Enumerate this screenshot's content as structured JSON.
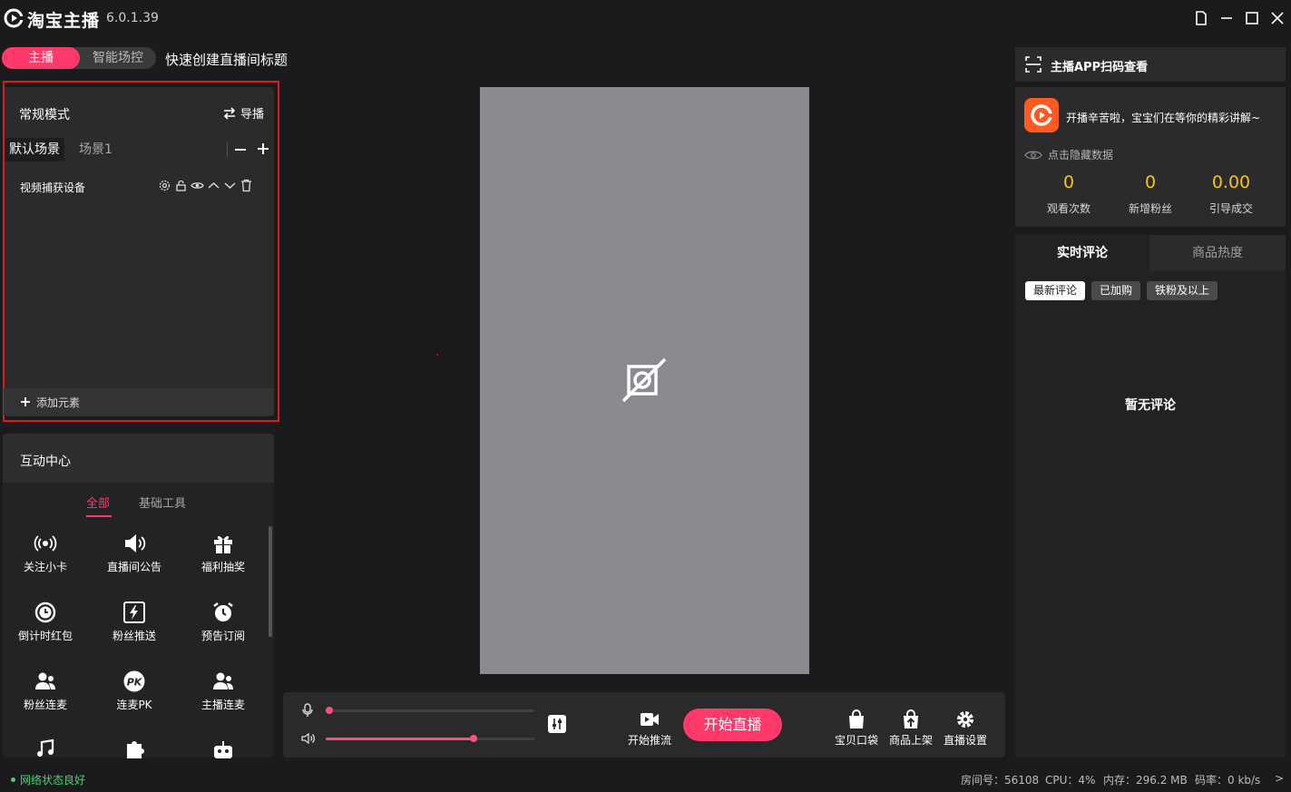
{
  "app": {
    "name": "淘宝主播",
    "version": "6.0.1.39"
  },
  "mode_toggle": {
    "active": "主播",
    "inactive": "智能场控"
  },
  "title_prompt": "快速创建直播间标题",
  "scene_panel": {
    "mode_title": "常规模式",
    "guide_label": "导播",
    "tabs": [
      "默认场景",
      "场景1"
    ],
    "sources": [
      {
        "label": "视频捕获设备"
      }
    ],
    "add_element_label": "添加元素"
  },
  "interaction_center": {
    "title": "互动中心",
    "tabs": [
      "全部",
      "基础工具"
    ],
    "tools": [
      {
        "label": "关注小卡",
        "icon": "broadcast-icon"
      },
      {
        "label": "直播间公告",
        "icon": "speaker-icon"
      },
      {
        "label": "福利抽奖",
        "icon": "gift-icon"
      },
      {
        "label": "倒计时红包",
        "icon": "clock-icon"
      },
      {
        "label": "粉丝推送",
        "icon": "lightning-icon"
      },
      {
        "label": "预告订阅",
        "icon": "alarm-icon"
      },
      {
        "label": "粉丝连麦",
        "icon": "users-icon"
      },
      {
        "label": "连麦PK",
        "icon": "pk-icon"
      },
      {
        "label": "主播连麦",
        "icon": "users-icon"
      },
      {
        "label": "",
        "icon": "music-icon"
      },
      {
        "label": "",
        "icon": "puzzle-icon"
      },
      {
        "label": "",
        "icon": "robot-icon"
      }
    ]
  },
  "controls": {
    "mic_level": 0.0,
    "volume_level": 0.71,
    "start_stream_label": "开始推流",
    "start_live_label": "开始直播",
    "right_buttons": [
      {
        "label": "宝贝口袋",
        "icon": "bag-icon"
      },
      {
        "label": "商品上架",
        "icon": "upload-icon"
      },
      {
        "label": "直播设置",
        "icon": "gear-icon"
      }
    ]
  },
  "right_panel": {
    "scan_title": "主播APP扫码查看",
    "greeting": "开播辛苦啦，宝宝们在等你的精彩讲解~",
    "hide_data_label": "点击隐藏数据",
    "stats": [
      {
        "value": "0",
        "label": "观看次数"
      },
      {
        "value": "0",
        "label": "新增粉丝"
      },
      {
        "value": "0.00",
        "label": "引导成交"
      }
    ],
    "comment_tabs": [
      "实时评论",
      "商品热度"
    ],
    "filters": [
      "最新评论",
      "已加购",
      "铁粉及以上"
    ],
    "empty_text": "暂无评论"
  },
  "status_bar": {
    "network": "网络状态良好",
    "room": "房间号：56108",
    "cpu": "CPU：4%",
    "memory": "内存：296.2 MB",
    "bitrate": "码率：0 kb/s",
    "more": ">"
  },
  "colors": {
    "accent": "#ff3a6b",
    "stat_value": "#f4c21b",
    "network_ok": "#49d36c",
    "highlight_border": "#d71d1d"
  }
}
